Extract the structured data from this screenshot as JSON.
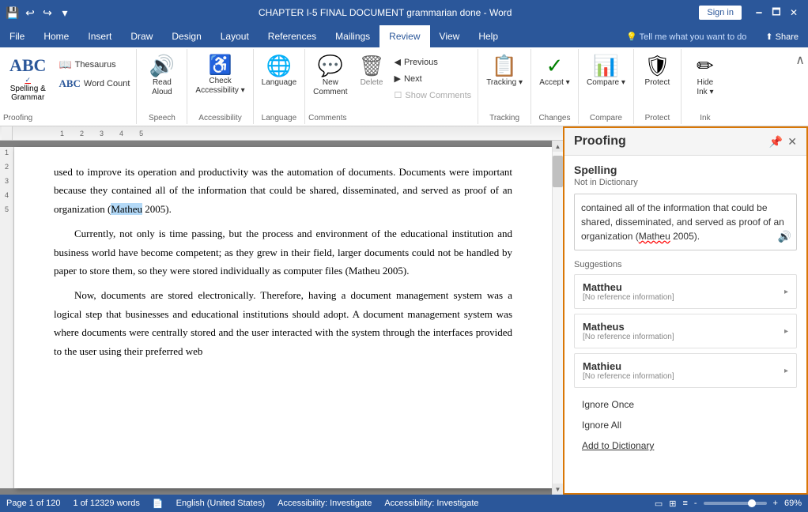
{
  "titleBar": {
    "title": "CHAPTER I-5 FINAL DOCUMENT grammarian done - Word",
    "signinLabel": "Sign in",
    "windowControls": [
      "🗕",
      "🗖",
      "✕"
    ]
  },
  "menuBar": {
    "items": [
      "File",
      "Home",
      "Insert",
      "Draw",
      "Design",
      "Layout",
      "References",
      "Mailings",
      "Review",
      "View",
      "Help"
    ],
    "activeItem": "Review",
    "helpIcon": "💡",
    "tellMePlaceholder": "Tell me what you want to do",
    "shareLabel": "Share"
  },
  "ribbon": {
    "groups": [
      {
        "name": "Proofing",
        "buttons": [
          {
            "id": "spelling",
            "icon": "ABC✓",
            "label": "Spelling &\nGrammar"
          },
          {
            "id": "thesaurus",
            "icon": "📖",
            "label": "Thesaurus",
            "small": true
          },
          {
            "id": "wordcount",
            "icon": "ABC",
            "label": "Word Count",
            "small": true
          }
        ]
      },
      {
        "name": "Speech",
        "buttons": [
          {
            "id": "readaloud",
            "icon": "🔊",
            "label": "Read\nAloud"
          }
        ]
      },
      {
        "name": "Accessibility",
        "buttons": [
          {
            "id": "checkaccessibility",
            "icon": "✓",
            "label": "Check\nAccessibility"
          }
        ]
      },
      {
        "name": "Language",
        "buttons": [
          {
            "id": "language",
            "icon": "🌐",
            "label": "Language"
          }
        ]
      },
      {
        "name": "Comments",
        "buttons": [
          {
            "id": "newcomment",
            "icon": "💬",
            "label": "New\nComment"
          },
          {
            "id": "delete",
            "icon": "🗑",
            "label": "Delete"
          }
        ],
        "navItems": [
          {
            "id": "previous",
            "label": "Previous",
            "disabled": false
          },
          {
            "id": "next",
            "label": "Next",
            "disabled": false
          }
        ],
        "showComments": "Show Comments"
      },
      {
        "name": "Tracking",
        "buttons": [
          {
            "id": "tracking",
            "icon": "📋",
            "label": "Tracking"
          }
        ]
      },
      {
        "name": "Changes",
        "buttons": [
          {
            "id": "accept",
            "icon": "✓",
            "label": "Accept"
          }
        ]
      },
      {
        "name": "Compare",
        "buttons": [
          {
            "id": "compare",
            "icon": "📊",
            "label": "Compare"
          }
        ]
      },
      {
        "name": "Protect",
        "buttons": [
          {
            "id": "protect",
            "icon": "🔒",
            "label": "Protect"
          }
        ]
      },
      {
        "name": "Ink",
        "buttons": [
          {
            "id": "hideink",
            "icon": "✏",
            "label": "Hide\nInk"
          }
        ]
      }
    ]
  },
  "document": {
    "paragraphs": [
      "used to improve its operation and productivity was the automation of documents. Documents were important because they contained all of the information that could be shared, disseminated, and served as proof of an organization (Matheu 2005).",
      "Currently, not only is time passing, but the process and environment of the educational institution and business world have become competent; as they grew in their field, larger documents could not be handled by paper to store them, so they were stored individually as computer files (Matheu 2005).",
      "Now, documents are stored electronically. Therefore, having a document management system was a logical step that businesses and educational institutions should adopt. A document management system was where documents were centrally stored and the user interacted with the system through the interfaces provided to the user using their preferred web"
    ],
    "highlightedWord": "Matheu"
  },
  "proofingPanel": {
    "title": "Proofing",
    "sections": {
      "spelling": {
        "title": "Spelling",
        "subtitle": "Not in Dictionary",
        "errorText": "contained all of the information that could be shared, disseminated, and served as proof of an organization (Matheu 2005).",
        "misspelledWord": "Matheu"
      },
      "suggestions": {
        "title": "Suggestions",
        "items": [
          {
            "word": "Mattheu",
            "ref": "[No reference information]"
          },
          {
            "word": "Matheus",
            "ref": "[No reference information]"
          },
          {
            "word": "Mathieu",
            "ref": "[No reference information]"
          }
        ]
      },
      "actions": {
        "ignoreOnce": "Ignore Once",
        "ignoreAll": "Ignore All",
        "addToDictionary": "Add to Dictionary"
      }
    }
  },
  "statusBar": {
    "page": "Page 1 of 120",
    "words": "1 of 12329 words",
    "language": "English (United States)",
    "accessibility": "Accessibility: Investigate",
    "zoom": "69%"
  }
}
